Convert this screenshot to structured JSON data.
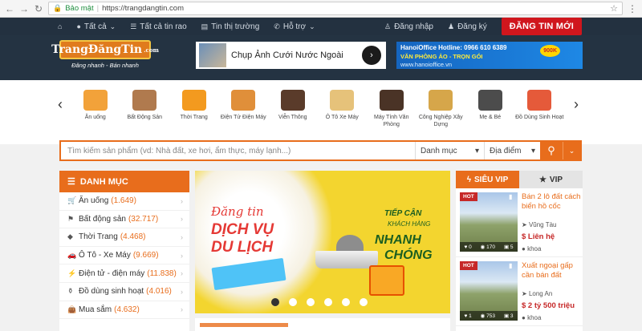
{
  "browser": {
    "security": "Bảo mật",
    "url": "https://trangdangtin.com"
  },
  "topnav": {
    "items": [
      {
        "icon": "home-icon",
        "label": ""
      },
      {
        "icon": "location-pin-icon",
        "label": "Tất cả"
      },
      {
        "icon": "list-icon",
        "label": "Tất cả tin rao"
      },
      {
        "icon": "newspaper-icon",
        "label": "Tin thị trường"
      },
      {
        "icon": "phone-icon",
        "label": "Hỗ trợ"
      }
    ],
    "login": "Đăng nhập",
    "register": "Đăng ký",
    "post_button": "ĐĂNG TIN MỚI"
  },
  "header": {
    "logo_text": "TrangĐăngTin",
    "logo_suffix": ".com",
    "logo_tagline": "Đăng nhanh - Bán nhanh",
    "ad1_text": "Chụp Ảnh Cưới Nước Ngoài",
    "ad2": {
      "line1": "HanoiOffice Hotline: 0966 610 6389",
      "line2": "VĂN PHÒNG ẢO - TRỌN GÓI",
      "line3": "www.hanoioffice.vn",
      "badge": "900K"
    }
  },
  "categories": [
    {
      "label": "Ăn uống",
      "icon": "drink-icon",
      "color": "#f2a23a"
    },
    {
      "label": "Bất Động Sản",
      "icon": "building-icon",
      "color": "#b07a4e"
    },
    {
      "label": "Thời Trang",
      "icon": "raincoat-icon",
      "color": "#f39a1f"
    },
    {
      "label": "Điện Tử Điện Máy",
      "icon": "washing-machine-icon",
      "color": "#e08f3a"
    },
    {
      "label": "Viễn Thông",
      "icon": "phone-device-icon",
      "color": "#5a3b2a"
    },
    {
      "label": "Ô Tô Xe Máy",
      "icon": "car-icon",
      "color": "#e6c27a"
    },
    {
      "label": "Máy Tính Văn Phòng",
      "icon": "laptop-icon",
      "color": "#4a3326"
    },
    {
      "label": "Công Nghiệp Xây Dựng",
      "icon": "worker-icon",
      "color": "#d6a64a"
    },
    {
      "label": "Mẹ & Bé",
      "icon": "stroller-icon",
      "color": "#4c4c4c"
    },
    {
      "label": "Đồ Dùng Sinh Hoạt",
      "icon": "cooler-icon",
      "color": "#e55a3a"
    }
  ],
  "search": {
    "placeholder": "Tìm kiếm sản phẩm (vd: Nhà đất, xe hơi, ẩm thực, máy lạnh...)",
    "category_label": "Danh mục",
    "location_label": "Địa điểm"
  },
  "sidebar": {
    "title": "DANH MỤC",
    "items": [
      {
        "icon": "cart-icon",
        "label": "Ăn uống",
        "count": "(1.649)"
      },
      {
        "icon": "signpost-icon",
        "label": "Bất động sản",
        "count": "(32.717)"
      },
      {
        "icon": "diamond-icon",
        "label": "Thời Trang",
        "count": "(4.468)"
      },
      {
        "icon": "car-icon",
        "label": "Ô Tô - Xe Máy",
        "count": "(9.669)"
      },
      {
        "icon": "plug-icon",
        "label": "Điện tử - điện máy",
        "count": "(11.838)"
      },
      {
        "icon": "bottle-icon",
        "label": "Đồ dùng sinh hoạt",
        "count": "(4.016)"
      },
      {
        "icon": "bag-icon",
        "label": "Mua sắm",
        "count": "(4.632)"
      }
    ]
  },
  "banner": {
    "left_1": "Đăng tin",
    "left_2": "DỊCH VỤ",
    "left_3": "DU LỊCH",
    "right_1": "TIẾP CẬN",
    "right_2": "KHÁCH HÀNG",
    "right_3": "NHANH",
    "right_4": "CHÓNG",
    "slides": 6,
    "active_slide": 1
  },
  "listings": {
    "tab_vip_super": "SIÊU VIP",
    "tab_vip": "VIP",
    "cards": [
      {
        "badge": "HOT",
        "title": "Bán 2 lô đất cách biển hồ cốc",
        "location": "Vũng Tàu",
        "price": "$ Liên hệ",
        "user": "khoa",
        "likes": "0",
        "views": "170",
        "photos": "5"
      },
      {
        "badge": "HOT",
        "title": "Xuất ngoại gấp cần bán đất",
        "location": "Long An",
        "price": "$ 2 tỷ 500 triệu",
        "user": "khoa",
        "likes": "1",
        "views": "753",
        "photos": "3"
      }
    ]
  }
}
